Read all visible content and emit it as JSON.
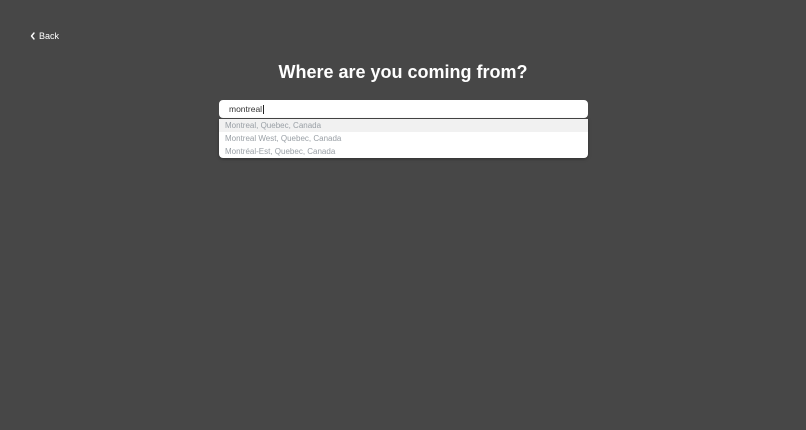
{
  "nav": {
    "back_label": "Back",
    "back_icon": "chevron-left-icon"
  },
  "page": {
    "title": "Where are you coming from?"
  },
  "search": {
    "value": "montreal",
    "suggestions": [
      {
        "label": "Montreal, Quebec, Canada"
      },
      {
        "label": "Montreal West, Quebec, Canada"
      },
      {
        "label": "Montréal-Est, Quebec, Canada"
      }
    ]
  },
  "colors": {
    "background": "#474747",
    "text_primary": "#ffffff",
    "suggestion_text": "#9aa0a6",
    "suggestion_highlight": "#f1f1f1"
  }
}
